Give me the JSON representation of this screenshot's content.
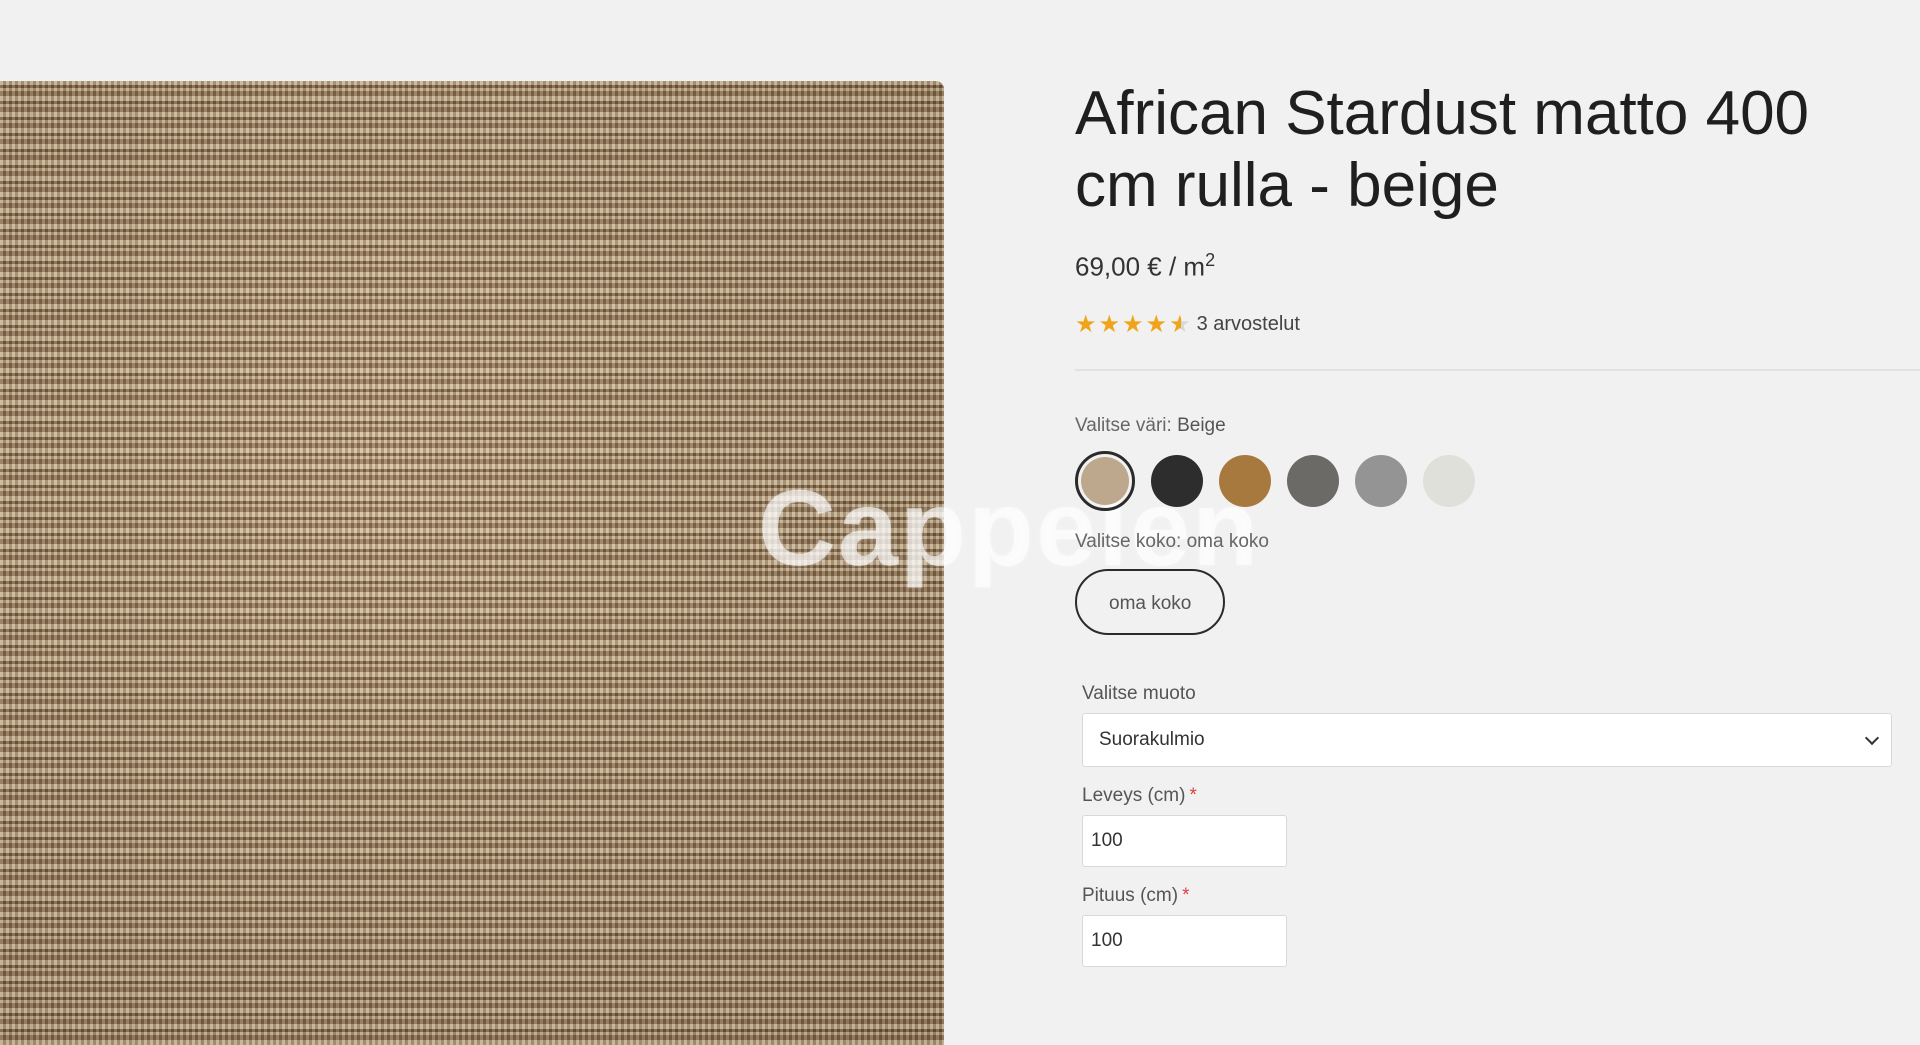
{
  "product": {
    "title": "African Stardust matto 400 cm rulla - beige",
    "price_text": "69,00 € / m",
    "price_unit_sup": "2",
    "rating": {
      "value": 4.5,
      "max": 5,
      "reviews_text": "3 arvostelut"
    }
  },
  "watermark": "Cappelen",
  "color_picker": {
    "label": "Valitse väri:",
    "selected_value": "Beige",
    "swatches": [
      {
        "name": "beige",
        "color": "#bda88e",
        "selected": true
      },
      {
        "name": "black",
        "color": "#2d2d2d",
        "selected": false
      },
      {
        "name": "amber",
        "color": "#a8793e",
        "selected": false
      },
      {
        "name": "dark-grey",
        "color": "#6c6a67",
        "selected": false
      },
      {
        "name": "grey",
        "color": "#959494",
        "selected": false
      },
      {
        "name": "light",
        "color": "#e0e0da",
        "selected": false
      }
    ]
  },
  "size_picker": {
    "label": "Valitse koko:",
    "selected_value": "oma koko",
    "options": [
      "oma koko"
    ]
  },
  "shape": {
    "label": "Valitse muoto",
    "value": "Suorakulmio"
  },
  "width_field": {
    "label": "Leveys (cm)",
    "required_mark": "*",
    "value": "100"
  },
  "length_field": {
    "label": "Pituus (cm)",
    "required_mark": "*",
    "value": "100"
  },
  "colors": {
    "star": "#f0a419",
    "required": "#e04040"
  }
}
